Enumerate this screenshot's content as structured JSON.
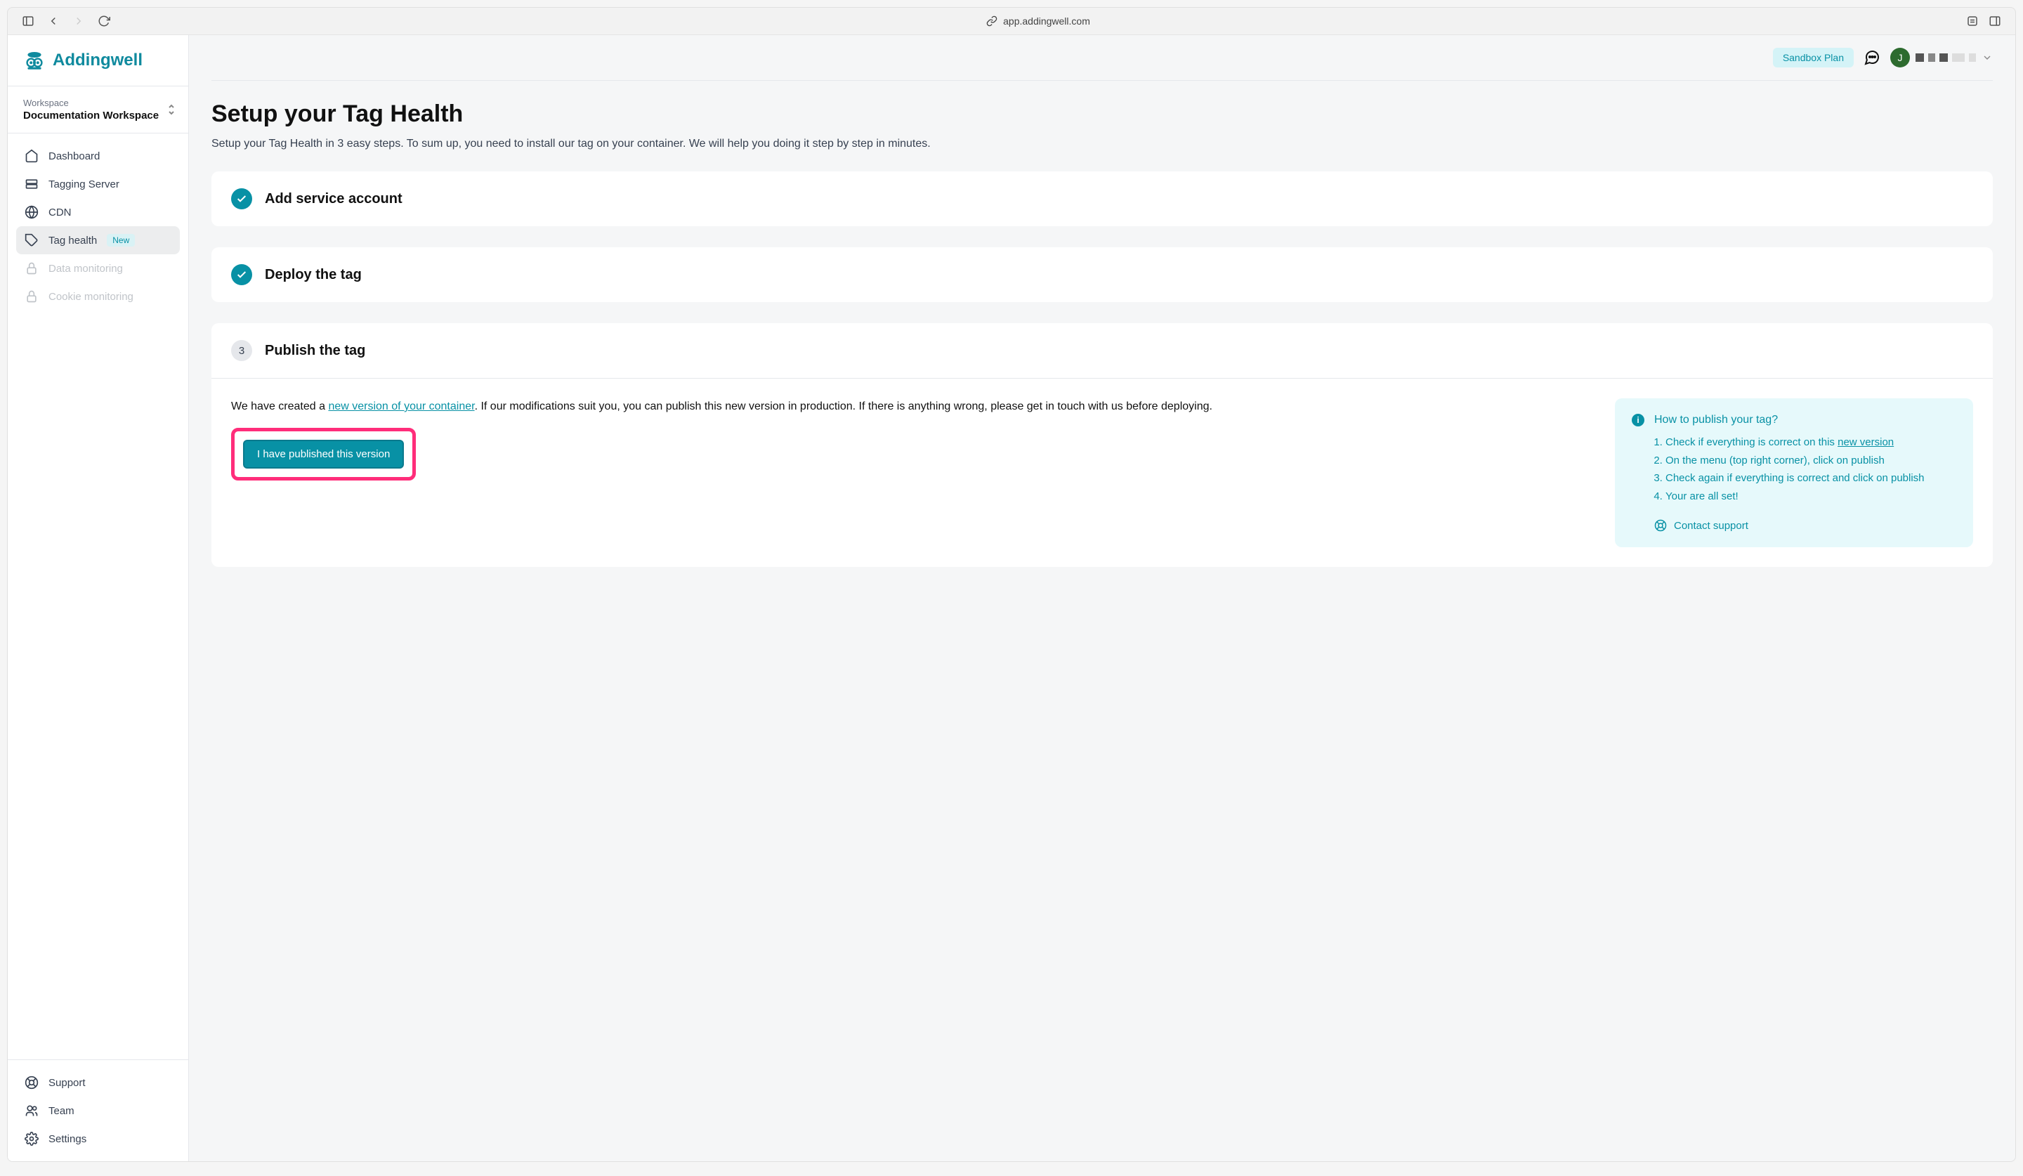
{
  "browser": {
    "url": "app.addingwell.com"
  },
  "brand": "Addingwell",
  "workspace": {
    "label": "Workspace",
    "name": "Documentation Workspace"
  },
  "nav": {
    "items": [
      {
        "label": "Dashboard"
      },
      {
        "label": "Tagging Server"
      },
      {
        "label": "CDN"
      },
      {
        "label": "Tag health",
        "badge": "New"
      },
      {
        "label": "Data monitoring"
      },
      {
        "label": "Cookie monitoring"
      }
    ],
    "footer": [
      {
        "label": "Support"
      },
      {
        "label": "Team"
      },
      {
        "label": "Settings"
      }
    ]
  },
  "topbar": {
    "plan": "Sandbox Plan",
    "avatar": "J"
  },
  "page": {
    "title": "Setup your Tag Health",
    "subtitle": "Setup your Tag Health in 3 easy steps. To sum up, you need to install our tag on your container. We will help you doing it step by step in minutes."
  },
  "steps": {
    "s1": {
      "title": "Add service account"
    },
    "s2": {
      "title": "Deploy the tag"
    },
    "s3": {
      "number": "3",
      "title": "Publish the tag",
      "text_pre": "We have created a ",
      "link": "new version of your container",
      "text_post": ". If our modifications suit you, you can publish this new version in production. If there is anything wrong, please get in touch with us before deploying.",
      "button": "I have published this version",
      "info": {
        "title": "How to publish your tag?",
        "items": {
          "i1_pre": "Check if everything is correct on this ",
          "i1_link": "new version",
          "i2": "On the menu (top right corner), click on publish",
          "i3": "Check again if everything is correct and click on publish",
          "i4": "Your are all set!"
        },
        "contact": "Contact support"
      }
    }
  }
}
